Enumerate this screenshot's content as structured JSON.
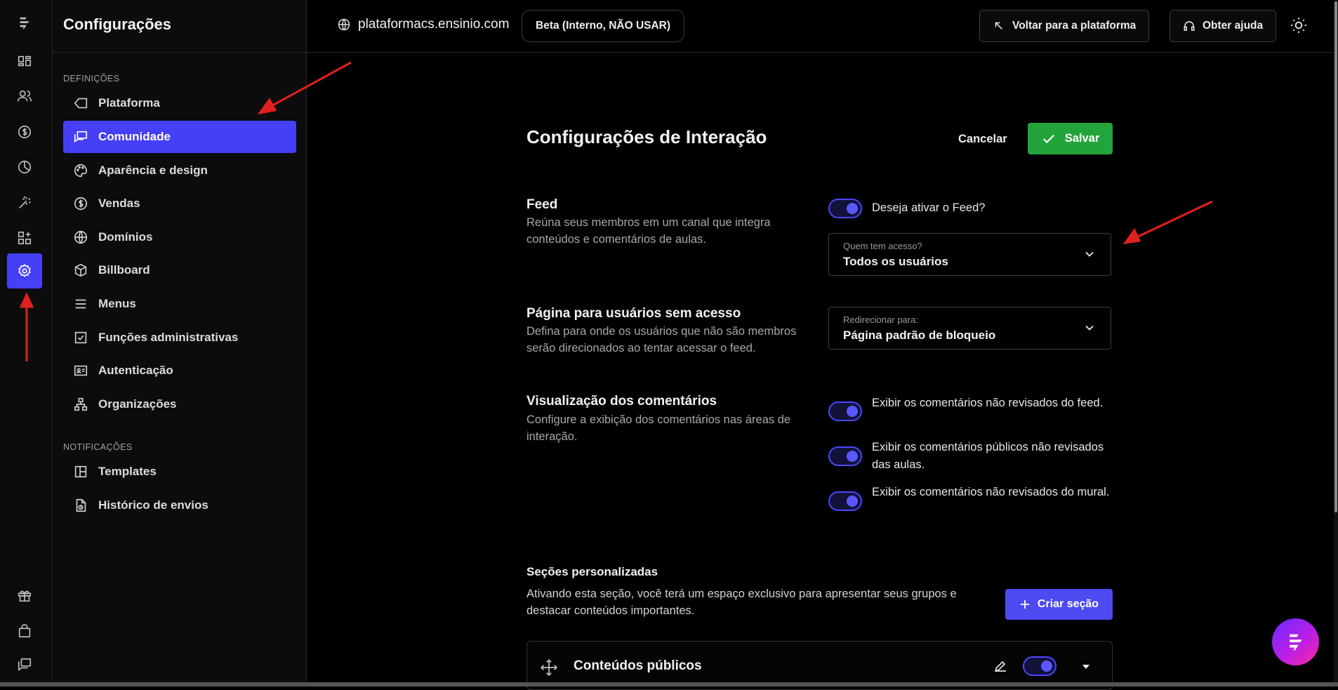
{
  "sidebar": {
    "title": "Configurações",
    "sections": {
      "definitions": "DEFINIÇÕES",
      "notifications": "NOTIFICAÇÕES"
    },
    "items": [
      {
        "label": "Plataforma",
        "icon": "tag-icon"
      },
      {
        "label": "Comunidade",
        "icon": "chat-bubbles-icon",
        "active": true
      },
      {
        "label": "Aparência e design",
        "icon": "palette-icon"
      },
      {
        "label": "Vendas",
        "icon": "dollar-circle-icon"
      },
      {
        "label": "Domínios",
        "icon": "globe-icon"
      },
      {
        "label": "Billboard",
        "icon": "box-icon"
      },
      {
        "label": "Menus",
        "icon": "menu-lines-icon"
      },
      {
        "label": "Funções administrativas",
        "icon": "checkbox-icon"
      },
      {
        "label": "Autenticação",
        "icon": "id-card-icon"
      },
      {
        "label": "Organizações",
        "icon": "org-chart-icon"
      },
      {
        "label": "Templates",
        "icon": "layout-icon"
      },
      {
        "label": "Histórico de envios",
        "icon": "file-history-icon"
      }
    ]
  },
  "topbar": {
    "domain": "plataformacs.ensinio.com",
    "environment_badge": "Beta (Interno, NÃO USAR)",
    "back_button": "Voltar para a plataforma",
    "help_button": "Obter ajuda"
  },
  "main": {
    "title": "Configurações de Interação",
    "cancel_label": "Cancelar",
    "save_label": "Salvar",
    "feed": {
      "title": "Feed",
      "description": "Reúna seus membros em um canal que integra conteúdos e comentários de aulas.",
      "toggle_label": "Deseja ativar o Feed?",
      "toggle_on": true,
      "access_select": {
        "label": "Quem tem acesso?",
        "value": "Todos os usuários"
      }
    },
    "no_access": {
      "title": "Página para usuários sem acesso",
      "description": "Defina para onde os usuários que não são membros serão direcionados ao tentar acessar o feed.",
      "redirect_select": {
        "label": "Redirecionar para:",
        "value": "Página padrão de bloqueio"
      }
    },
    "comments": {
      "title": "Visualização dos comentários",
      "description": "Configure a exibição dos comentários nas áreas de interação.",
      "toggles": [
        {
          "label": "Exibir os comentários não revisados do feed.",
          "on": true
        },
        {
          "label": "Exibir os comentários públicos não revisados das aulas.",
          "on": true
        },
        {
          "label": "Exibir os comentários não revisados do mural.",
          "on": true
        }
      ]
    },
    "custom_sections": {
      "title": "Seções personalizadas",
      "description": "Ativando esta seção, você terá um espaço exclusivo para apresentar seus grupos e destacar conteúdos importantes.",
      "create_button": "Criar seção",
      "items": [
        {
          "title": "Conteúdos públicos",
          "on": true
        }
      ]
    }
  },
  "colors": {
    "accent": "#4540f5",
    "save": "#22a43a",
    "annotation_arrow": "#e0201e"
  }
}
